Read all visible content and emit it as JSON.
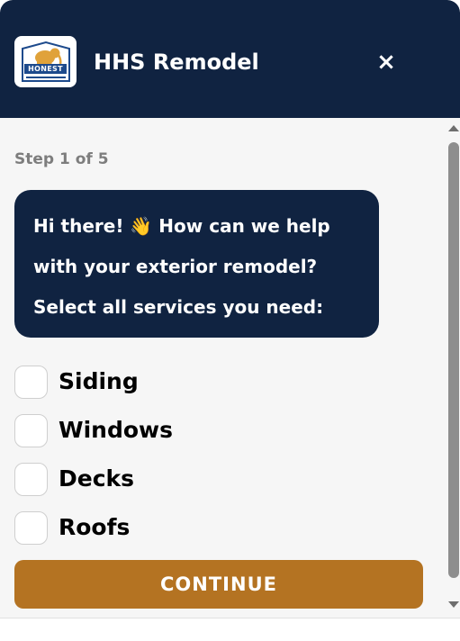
{
  "header": {
    "title": "HHS Remodel",
    "logo_text": "HONEST",
    "close_glyph": "×"
  },
  "step": "Step 1 of 5",
  "message": {
    "lines": [
      "Hi there! 👋 How can we help",
      "with your exterior remodel?",
      "Select all services you need:"
    ]
  },
  "options": [
    {
      "label": "Siding",
      "checked": false
    },
    {
      "label": "Windows",
      "checked": false
    },
    {
      "label": "Decks",
      "checked": false
    },
    {
      "label": "Roofs",
      "checked": false
    }
  ],
  "continue_label": "CONTINUE",
  "colors": {
    "header_bg": "#102341",
    "bubble_bg": "#102341",
    "accent": "#b47322",
    "panel_bg": "#f6f6f6"
  },
  "icons": {
    "logo": "elephant-logo-icon",
    "close": "close-icon",
    "wave": "waving-hand-emoji"
  }
}
